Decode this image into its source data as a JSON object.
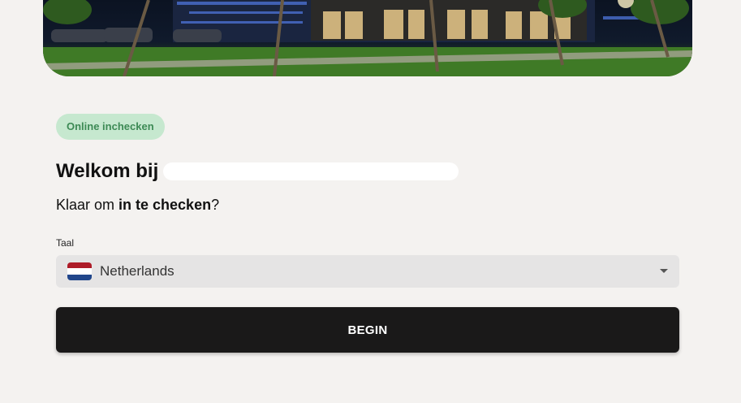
{
  "badge": {
    "label": "Online inchecken"
  },
  "welcome": {
    "prefix": "Welkom bij"
  },
  "subtitle": {
    "before": "Klaar om ",
    "bold": "in te checken",
    "after": "?"
  },
  "language": {
    "label": "Taal",
    "selected": "Netherlands",
    "flag_colors": [
      "#ae1c28",
      "#ffffff",
      "#21468b"
    ]
  },
  "begin_button": {
    "label": "BEGIN"
  },
  "colors": {
    "background": "#f4f2f0",
    "badge_bg": "#c6e8cf",
    "badge_text": "#3d8a55",
    "button_bg": "#1a1919"
  }
}
